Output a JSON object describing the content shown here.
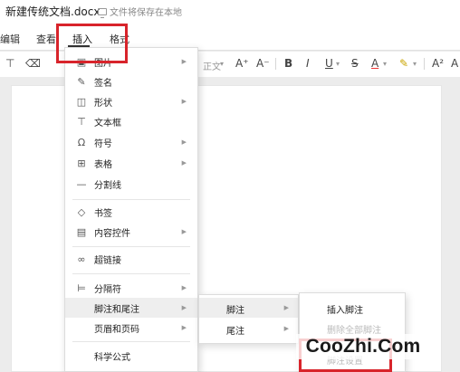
{
  "document": {
    "title": "新建传统文档.docx",
    "save_status": "文件将保存在本地"
  },
  "menubar": {
    "tabs": [
      {
        "label": "编辑"
      },
      {
        "label": "查看"
      },
      {
        "label": "插入"
      },
      {
        "label": "格式"
      }
    ],
    "active_tab": "插入"
  },
  "toolbar": {
    "style_suffix": "正文",
    "font_size_up": "A⁺",
    "font_size_down": "A⁻",
    "bold": "B",
    "italic": "I",
    "underline": "U",
    "strikethrough": "S",
    "font_color": "A",
    "superscript": "A²"
  },
  "insert_menu": {
    "items": [
      {
        "label": "图片",
        "icon": "image-icon",
        "has_submenu": true
      },
      {
        "label": "签名",
        "icon": "signature-pen-icon",
        "has_submenu": false
      },
      {
        "label": "形状",
        "icon": "shape-icon",
        "has_submenu": true
      },
      {
        "label": "文本框",
        "icon": "textbox-icon",
        "has_submenu": false
      },
      {
        "label": "符号",
        "icon": "omega-symbol-icon",
        "has_submenu": true
      },
      {
        "label": "表格",
        "icon": "table-grid-icon",
        "has_submenu": true
      },
      {
        "label": "分割线",
        "icon": "horizontal-line-icon",
        "has_submenu": false
      },
      {
        "label": "书签",
        "icon": "bookmark-tag-icon",
        "has_submenu": false
      },
      {
        "label": "内容控件",
        "icon": "content-control-icon",
        "has_submenu": true
      },
      {
        "label": "超链接",
        "icon": "hyperlink-icon",
        "has_submenu": false
      },
      {
        "label": "分隔符",
        "icon": "page-break-icon",
        "has_submenu": true
      },
      {
        "label": "脚注和尾注",
        "icon": "",
        "has_submenu": true
      },
      {
        "label": "页眉和页码",
        "icon": "",
        "has_submenu": true
      },
      {
        "label": "科学公式",
        "icon": "",
        "has_submenu": false
      }
    ]
  },
  "footnote_submenu": {
    "items": [
      {
        "label": "脚注",
        "has_submenu": true
      },
      {
        "label": "尾注",
        "has_submenu": true
      }
    ]
  },
  "footnote_actions": {
    "items": [
      {
        "label": "插入脚注",
        "enabled": true
      },
      {
        "label": "删除全部脚注",
        "enabled": false
      },
      {
        "label": "脚注设置",
        "enabled": false
      }
    ]
  },
  "watermark": {
    "text": "CooZhi.Com"
  },
  "colors": {
    "highlight_box": "#d8242b",
    "menu_hover": "#eeeeee"
  }
}
